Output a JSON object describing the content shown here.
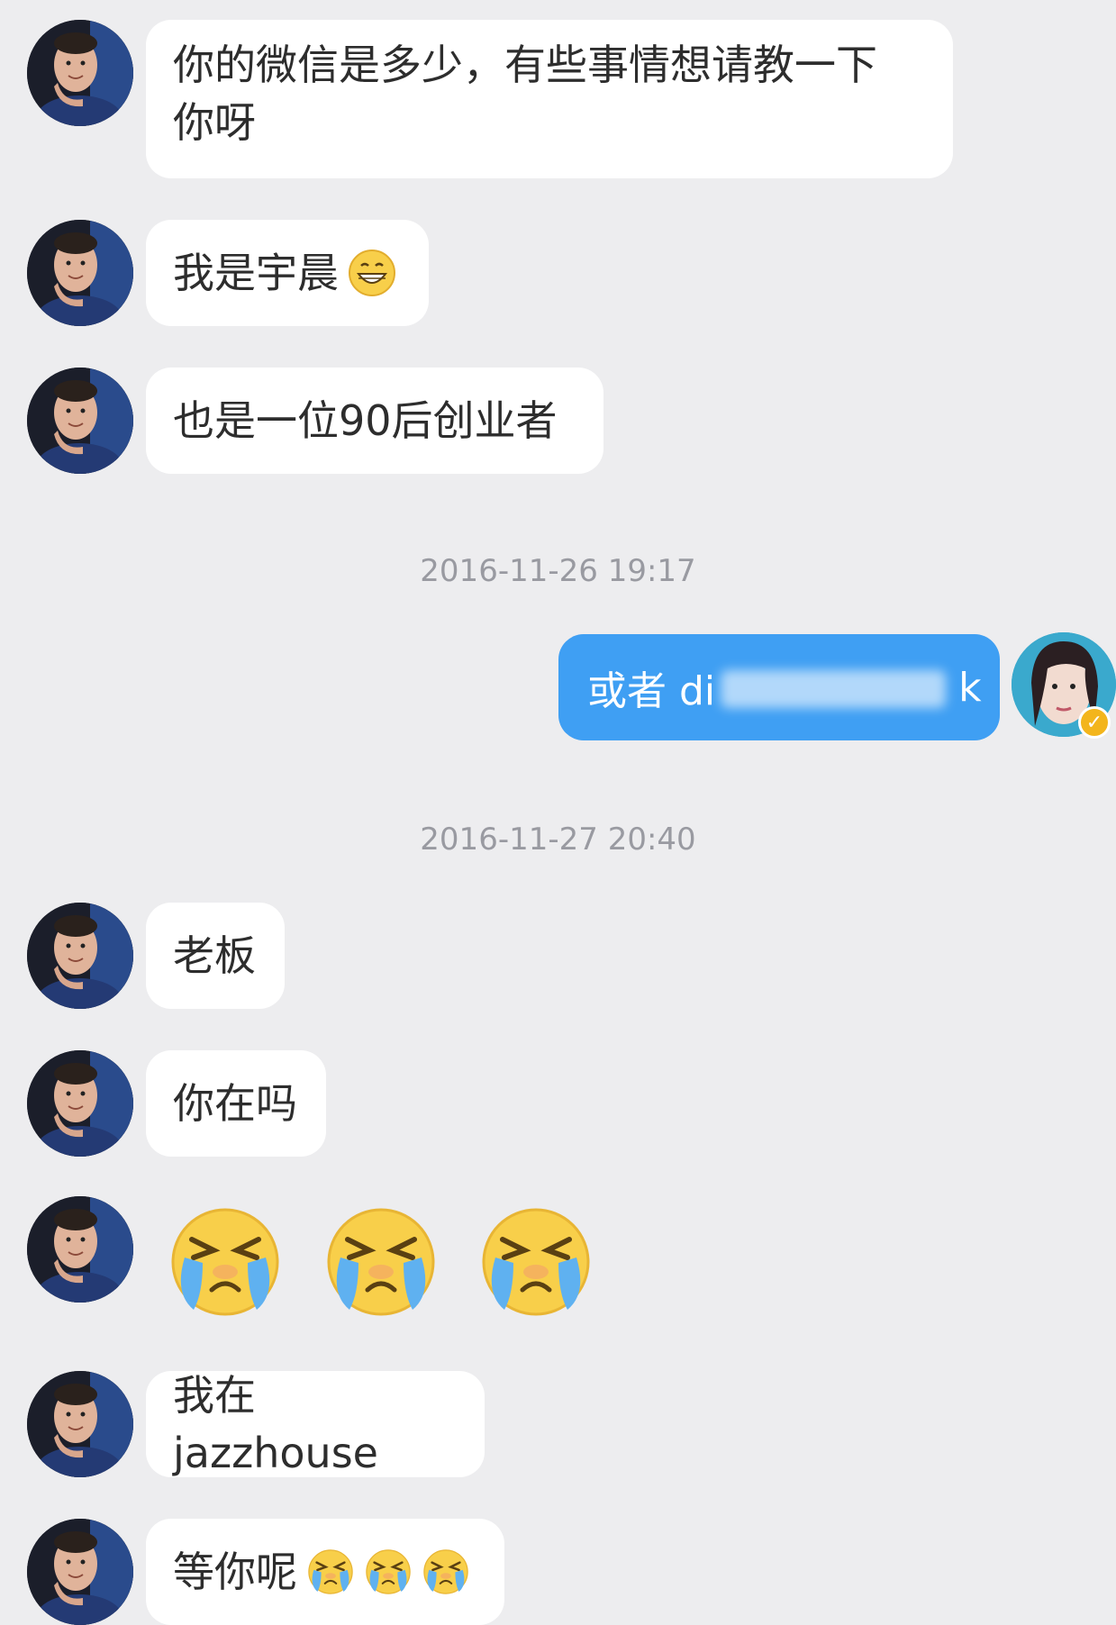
{
  "messages": [
    {
      "text_line1": "你的微信是多少，有些事情想请教一下",
      "text_line2": "你呀"
    },
    {
      "text": "我是宇晨",
      "emoji": "grin-emoji"
    },
    {
      "text": "也是一位90后创业者"
    },
    {
      "text": "或者 di",
      "text_end": "k",
      "redacted": true
    },
    {
      "text": "老板"
    },
    {
      "text": "你在吗"
    },
    {
      "emoji": "crying-emoji",
      "count": 3
    },
    {
      "text": "我在 jazzhouse"
    },
    {
      "text": "等你呢",
      "emoji": "crying-emoji",
      "count": 3
    }
  ],
  "timestamps": [
    "2016-11-26 19:17",
    "2016-11-27 20:40"
  ],
  "colors": {
    "background": "#ededef",
    "incoming_bubble": "#ffffff",
    "outgoing_bubble": "#3f9ff3",
    "verified_badge": "#f3b51c"
  },
  "icons": {
    "verified": "verified-badge-icon"
  }
}
